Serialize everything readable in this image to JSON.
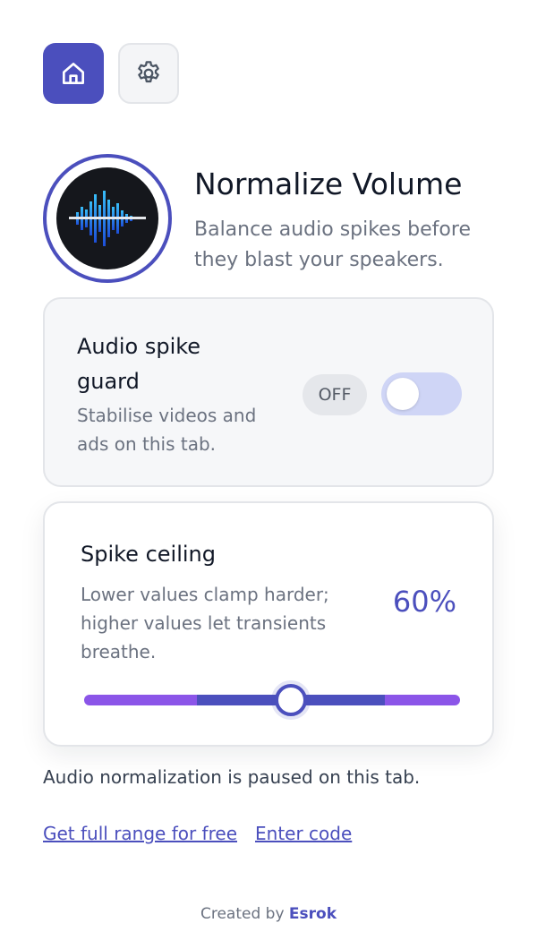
{
  "nav": {
    "items": [
      {
        "icon": "home-icon",
        "active": true
      },
      {
        "icon": "gear-icon",
        "active": false
      }
    ]
  },
  "header": {
    "title": "Normalize Volume",
    "subtitle": "Balance audio spikes before they blast your speakers.",
    "logo_icon": "audio-waveform-icon"
  },
  "guard": {
    "title": "Audio spike guard",
    "description": "Stabilise videos and ads on this tab.",
    "status_label": "OFF",
    "enabled": false
  },
  "ceiling": {
    "title": "Spike ceiling",
    "description": "Lower values clamp harder; higher values let transients breathe.",
    "value_label": "60%",
    "value": 0.55
  },
  "status_message": "Audio normalization is paused on this tab.",
  "links": {
    "full_range": "Get full range for free",
    "enter_code": "Enter code"
  },
  "footer": {
    "prefix": "Created by",
    "brand": "Esrok"
  },
  "colors": {
    "accent": "#4b4fbd",
    "slider_edge": "#8b55e8",
    "toggle_off_track": "#cfd5f6"
  }
}
